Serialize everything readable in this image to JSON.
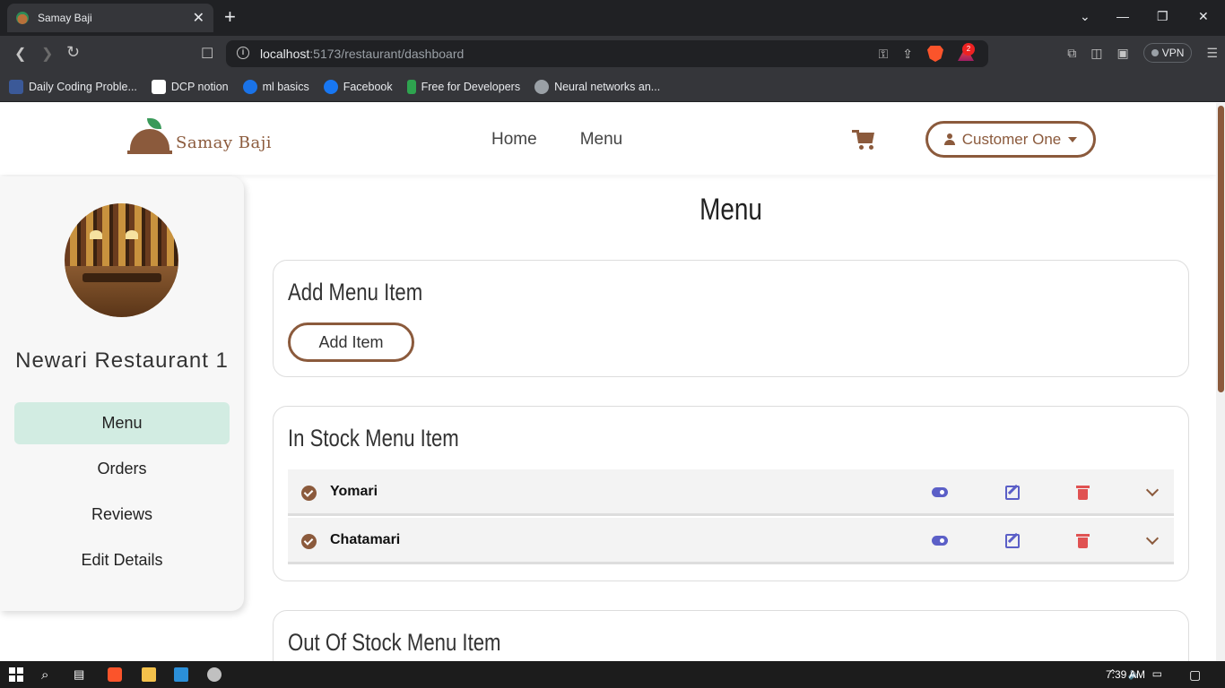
{
  "browser": {
    "tab_title": "Samay Baji",
    "url_host": "localhost",
    "url_path": ":5173/restaurant/dashboard",
    "notification_count": "2",
    "vpn_label": "VPN",
    "bookmarks": [
      {
        "label": "Daily Coding Proble...",
        "color": "#3b5998"
      },
      {
        "label": "DCP notion",
        "color": "#ffffff"
      },
      {
        "label": "ml basics",
        "color": "#1a73e8"
      },
      {
        "label": "Facebook",
        "color": "#1877f2"
      },
      {
        "label": "Free for Developers",
        "color": "#2ea44f"
      },
      {
        "label": "Neural networks an...",
        "color": "#9aa0a6"
      }
    ]
  },
  "header": {
    "logo_text": "Samay Baji",
    "nav": [
      "Home",
      "Menu"
    ],
    "user_label": "Customer One"
  },
  "sidebar": {
    "restaurant_name": "Newari Restaurant 1",
    "items": [
      {
        "label": "Menu",
        "active": true
      },
      {
        "label": "Orders",
        "active": false
      },
      {
        "label": "Reviews",
        "active": false
      },
      {
        "label": "Edit Details",
        "active": false
      }
    ]
  },
  "main": {
    "title": "Menu",
    "add_card": {
      "title": "Add Menu Item",
      "button_label": "Add Item"
    },
    "in_stock": {
      "title": "In Stock Menu Item",
      "items": [
        "Yomari",
        "Chatamari"
      ]
    },
    "out_of_stock": {
      "title": "Out Of Stock Menu Item"
    }
  },
  "taskbar": {
    "time": "7:39 AM"
  },
  "colors": {
    "brand": "#8b5a3c",
    "active_nav": "#d2ece2",
    "action_blue": "#5b5fc7",
    "delete_red": "#e05252"
  }
}
